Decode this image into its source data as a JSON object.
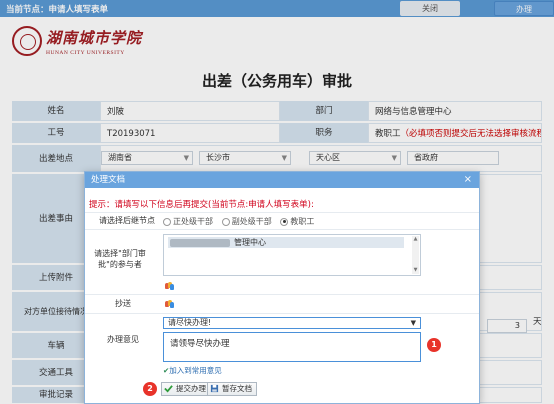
{
  "topbar": {
    "crumb_label": "当前节点",
    "crumb_sep": "：",
    "crumb_value": "申请人填写表单",
    "close_label": "关闭",
    "process_label": "办理"
  },
  "logo": {
    "name_cn": "湖南城市学院",
    "name_en": "HUNAN CITY UNIVERSITY"
  },
  "page_title": "出差（公务用车）审批",
  "form": {
    "name_label": "姓名",
    "name_value": "刘陂",
    "dept_label": "部门",
    "dept_value": "网络与信息管理中心",
    "id_label": "工号",
    "id_value": "T20193071",
    "post_label": "职务",
    "post_value": "教职工",
    "post_note": "（必填项否则提交后无法选择审核流程）",
    "place_label": "出差地点",
    "province": "湖南省",
    "city": "长沙市",
    "district": "天心区",
    "place_detail": "省政府",
    "reason_label": "出差事由",
    "attach_label": "上传附件",
    "reception_label": "对方单位接待情况",
    "days_value": "3",
    "days_unit": "天",
    "vehicle_label": "车辆",
    "transport_label": "交通工具",
    "record_label": "审批记录"
  },
  "dialog": {
    "title": "处理文档",
    "close_symbol": "×",
    "tip": "提示：请填写以下信息后再提交(当前节点:申请人填写表单):",
    "next_node_label": "请选择后继节点",
    "options": [
      "正处级干部",
      "副处级干部",
      "教职工"
    ],
    "selected_option": "教职工",
    "participants_label": "请选择\"部门审批\"的参与者",
    "participant_suffix": "管理中心",
    "cc_label": "抄送",
    "opinion_label": "办理意见",
    "opinion_select": "请尽快办理!",
    "opinion_text": "请领导尽快办理",
    "add_common_link": "加入到常用意见",
    "submit_label": "提交办理",
    "save_label": "暂存文档",
    "badge1": "1",
    "badge2": "2"
  },
  "colors": {
    "topbar": "#5b9bd5",
    "label_bg": "#d6e4f0",
    "dialog_head": "#6aa4de",
    "warn": "#d0021b",
    "badge": "#e8332a"
  }
}
